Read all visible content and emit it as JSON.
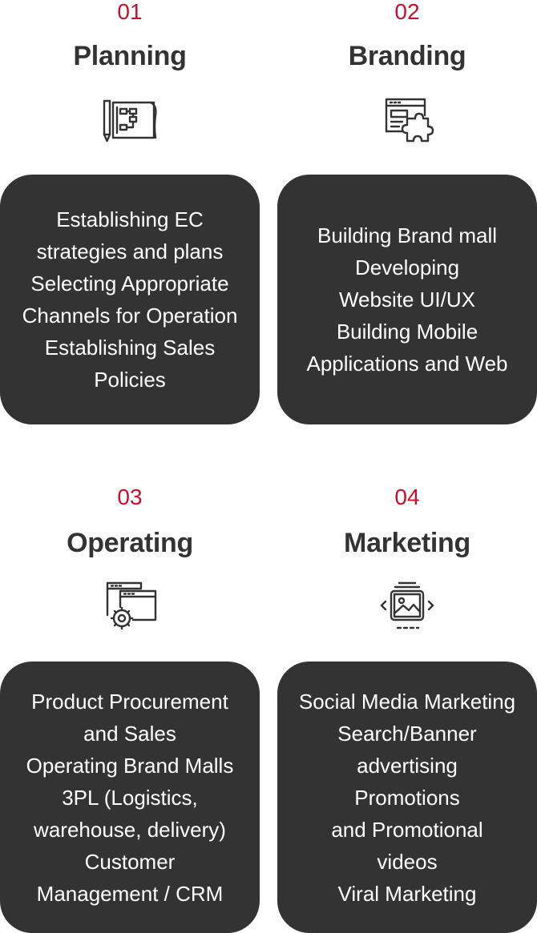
{
  "accent_color": "#c8102e",
  "card_color": "#333333",
  "sections": [
    {
      "number": "01",
      "title": "Planning",
      "icon": "blueprint-icon",
      "lines": [
        "Establishing EC",
        "strategies and plans",
        "Selecting Appropriate",
        "Channels for Operation",
        "Establishing Sales",
        "Policies"
      ]
    },
    {
      "number": "02",
      "title": "Branding",
      "icon": "browser-puzzle-icon",
      "lines": [
        "Building Brand mall",
        "Developing",
        "Website UI/UX",
        "Building Mobile",
        "Applications and Web"
      ]
    },
    {
      "number": "03",
      "title": "Operating",
      "icon": "browser-gear-icon",
      "lines": [
        "Product Procurement",
        "and Sales",
        "Operating Brand Malls",
        "3PL (Logistics,",
        "warehouse, delivery)",
        "Customer",
        "Management / CRM"
      ]
    },
    {
      "number": "04",
      "title": "Marketing",
      "icon": "image-carousel-icon",
      "lines": [
        "Social Media Marketing",
        "Search/Banner",
        "advertising",
        "Promotions",
        "and Promotional",
        "videos",
        "Viral Marketing"
      ]
    }
  ]
}
